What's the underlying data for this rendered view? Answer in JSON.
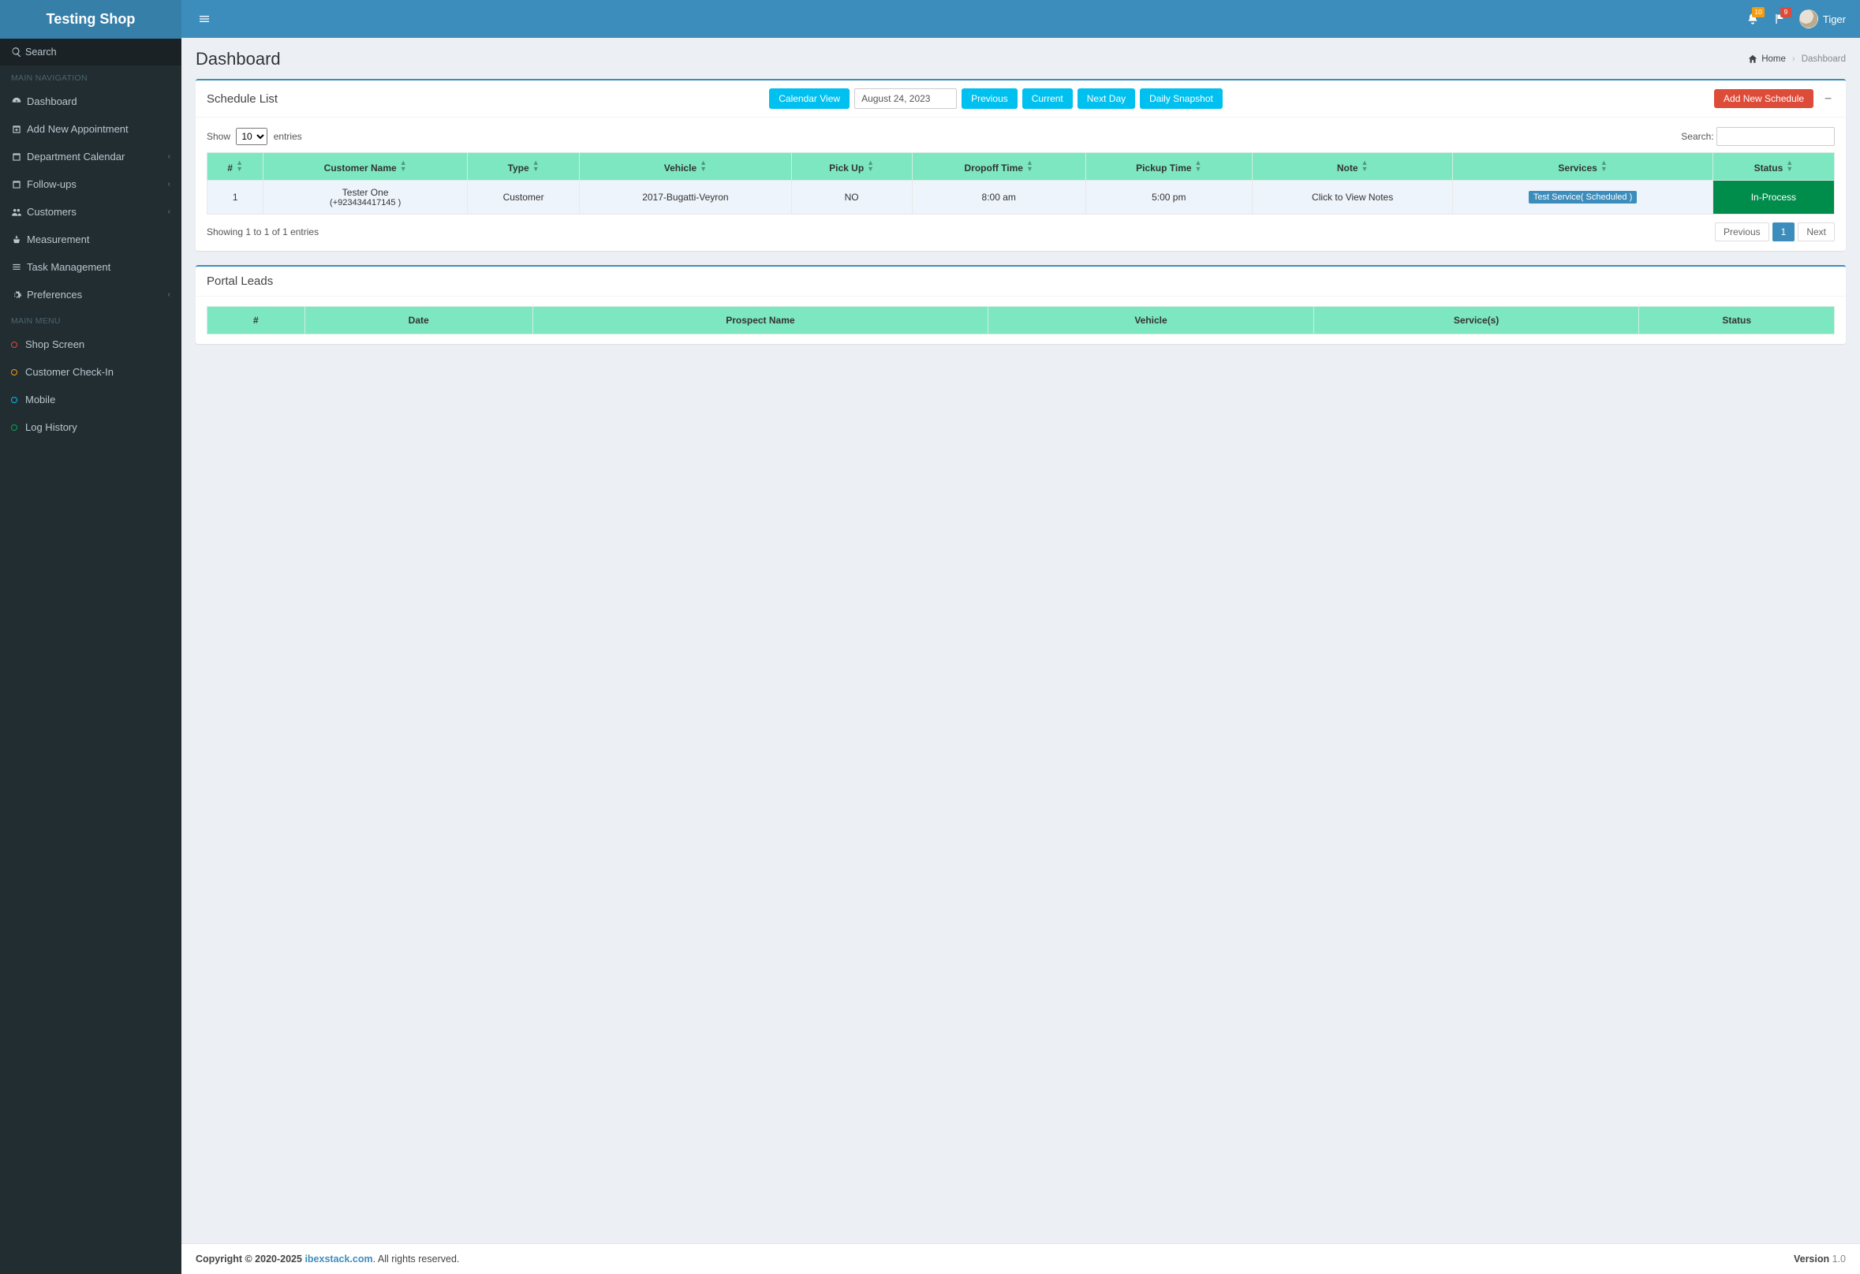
{
  "brand": "Testing Shop",
  "sidebar": {
    "search_label": "Search",
    "section_main_nav": "MAIN NAVIGATION",
    "items_main_nav": [
      {
        "label": "Dashboard",
        "icon": "dashboard-icon",
        "expandable": false
      },
      {
        "label": "Add New Appointment",
        "icon": "calendar-plus-icon",
        "expandable": false
      },
      {
        "label": "Department Calendar",
        "icon": "calendar-icon",
        "expandable": true
      },
      {
        "label": "Follow-ups",
        "icon": "calendar-icon",
        "expandable": true
      },
      {
        "label": "Customers",
        "icon": "users-icon",
        "expandable": true
      },
      {
        "label": "Measurement",
        "icon": "scale-icon",
        "expandable": false
      },
      {
        "label": "Task Management",
        "icon": "list-icon",
        "expandable": false
      },
      {
        "label": "Preferences",
        "icon": "gears-icon",
        "expandable": true
      }
    ],
    "section_main_menu": "MAIN MENU",
    "items_main_menu": [
      {
        "label": "Shop Screen",
        "dot": "red"
      },
      {
        "label": "Customer Check-In",
        "dot": "orange"
      },
      {
        "label": "Mobile",
        "dot": "cyan"
      },
      {
        "label": "Log History",
        "dot": "green"
      }
    ]
  },
  "topbar": {
    "notifications_badge": "10",
    "messages_badge": "9",
    "username": "Tiger"
  },
  "page": {
    "title": "Dashboard",
    "breadcrumb_home": "Home",
    "breadcrumb_current": "Dashboard"
  },
  "schedule": {
    "title": "Schedule List",
    "btn_calendar_view": "Calendar View",
    "date": "August 24, 2023",
    "btn_previous": "Previous",
    "btn_current": "Current",
    "btn_next_day": "Next Day",
    "btn_daily_snapshot": "Daily Snapshot",
    "btn_add_new": "Add New Schedule",
    "show_label_pre": "Show",
    "show_label_post": "entries",
    "show_value": "10",
    "search_label": "Search:",
    "columns": [
      "#",
      "Customer Name",
      "Type",
      "Vehicle",
      "Pick Up",
      "Dropoff Time",
      "Pickup Time",
      "Note",
      "Services",
      "Status"
    ],
    "rows": [
      {
        "num": "1",
        "customer_name": "Tester One",
        "customer_phone": "(+923434417145 )",
        "type": "Customer",
        "vehicle": "2017-Bugatti-Veyron",
        "pickup": "NO",
        "dropoff_time": "8:00 am",
        "pickup_time": "5:00 pm",
        "note": "Click to View Notes",
        "service_tag": "Test Service( Scheduled )",
        "status": "In-Process"
      }
    ],
    "info_text": "Showing 1 to 1 of 1 entries",
    "pager_prev": "Previous",
    "pager_page": "1",
    "pager_next": "Next"
  },
  "portal": {
    "title": "Portal Leads",
    "columns": [
      "#",
      "Date",
      "Prospect Name",
      "Vehicle",
      "Service(s)",
      "Status"
    ]
  },
  "footer": {
    "copyright_pre": "Copyright © 2020-2025 ",
    "link_text": "ibexstack.com",
    "copyright_post": ". All rights reserved.",
    "version_label": "Version",
    "version_value": " 1.0"
  }
}
